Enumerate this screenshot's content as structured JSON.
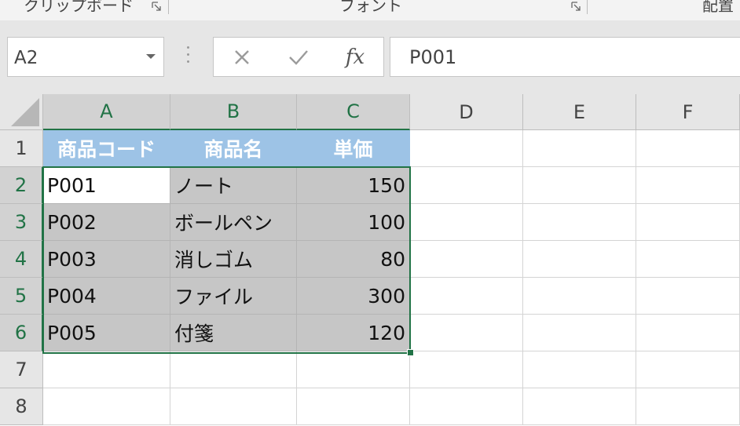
{
  "ribbon": {
    "groups": [
      {
        "label": "クリップボード"
      },
      {
        "label": "フォント"
      },
      {
        "label": "配置"
      }
    ]
  },
  "formula_bar": {
    "name_box": "A2",
    "cancel_icon": "x-icon",
    "enter_icon": "checkmark-icon",
    "fx_label": "fx",
    "value": "P001"
  },
  "sheet": {
    "columns": [
      "A",
      "B",
      "C",
      "D",
      "E",
      "F"
    ],
    "selected_columns": [
      "A",
      "B",
      "C"
    ],
    "rows": [
      "1",
      "2",
      "3",
      "4",
      "5",
      "6",
      "7",
      "8"
    ],
    "selected_rows": [
      "2",
      "3",
      "4",
      "5",
      "6"
    ],
    "header_row": [
      "商品コード",
      "商品名",
      "単価"
    ],
    "data_rows": [
      [
        "P001",
        "ノート",
        "150"
      ],
      [
        "P002",
        "ボールペン",
        "100"
      ],
      [
        "P003",
        "消しゴム",
        "80"
      ],
      [
        "P004",
        "ファイル",
        "300"
      ],
      [
        "P005",
        "付箋",
        "120"
      ]
    ],
    "active_cell": "A2",
    "selection_range": "A2:C6"
  },
  "colors": {
    "header_fill": "#9dc3e6",
    "selection_fill": "#c6c6c6",
    "selection_border": "#217346"
  }
}
